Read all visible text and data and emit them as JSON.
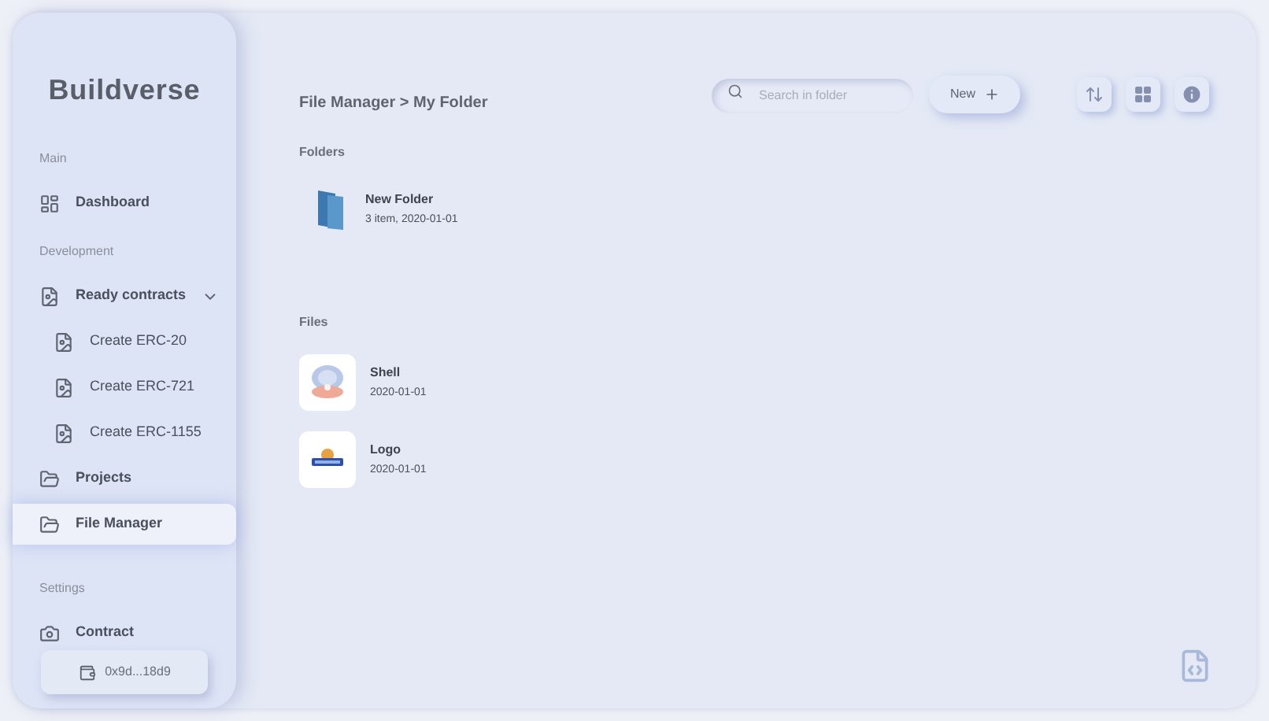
{
  "sidebar": {
    "logo": "Buildverse",
    "sections": [
      {
        "title": "Main",
        "items": [
          {
            "label": "Dashboard",
            "kind": "grid",
            "selected": false
          }
        ]
      },
      {
        "title": "Development",
        "items": [
          {
            "label": "Ready contracts",
            "kind": "file",
            "selected": false,
            "expanded": true,
            "children": [
              {
                "label": "Create ERC-20",
                "kind": "file",
                "selected": false
              },
              {
                "label": "Create ERC-721",
                "kind": "file",
                "selected": false
              },
              {
                "label": "Create ERC-1155",
                "kind": "file",
                "selected": false
              }
            ]
          },
          {
            "label": "Projects",
            "kind": "folder",
            "selected": false
          },
          {
            "label": "File Manager",
            "kind": "folder",
            "selected": true
          }
        ]
      },
      {
        "title": "Settings",
        "items": [
          {
            "label": "Contract",
            "kind": "camera",
            "selected": false
          }
        ]
      }
    ],
    "wallet": "0x9d...18d9"
  },
  "breadcrumb": "File Manager > My Folder",
  "search": {
    "placeholder": "Search in folder"
  },
  "new_button": "New",
  "folders": {
    "title": "Folders",
    "items": [
      {
        "name": "New Folder",
        "meta": "3 item, 2020-01-01"
      }
    ]
  },
  "files": {
    "title": "Files",
    "items": [
      {
        "name": "Shell",
        "meta": "2020-01-01",
        "kind": "picture"
      },
      {
        "name": "Logo",
        "meta": "2020-01-01",
        "kind": "picture"
      }
    ]
  }
}
